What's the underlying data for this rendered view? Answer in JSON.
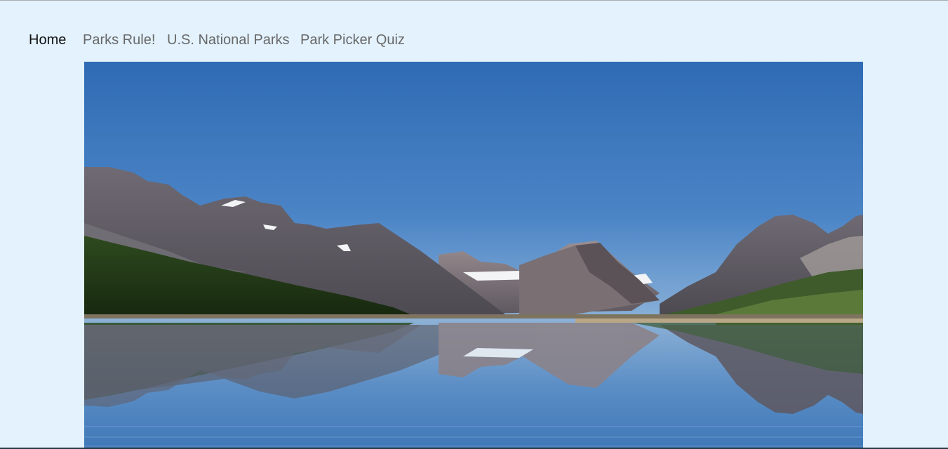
{
  "nav": {
    "items": [
      {
        "label": "Home",
        "active": true
      },
      {
        "label": "Parks Rule!",
        "active": false
      },
      {
        "label": "U.S. National Parks",
        "active": false
      },
      {
        "label": "Park Picker Quiz",
        "active": false
      }
    ]
  },
  "hero": {
    "subject": "mountain lake reflection landscape"
  },
  "colors": {
    "page_background": "#e3f2fd",
    "nav_active": "#111111",
    "nav_inactive": "#686868",
    "sky_top": "#2f6bb4",
    "sky_bottom": "#8ab1d8"
  }
}
